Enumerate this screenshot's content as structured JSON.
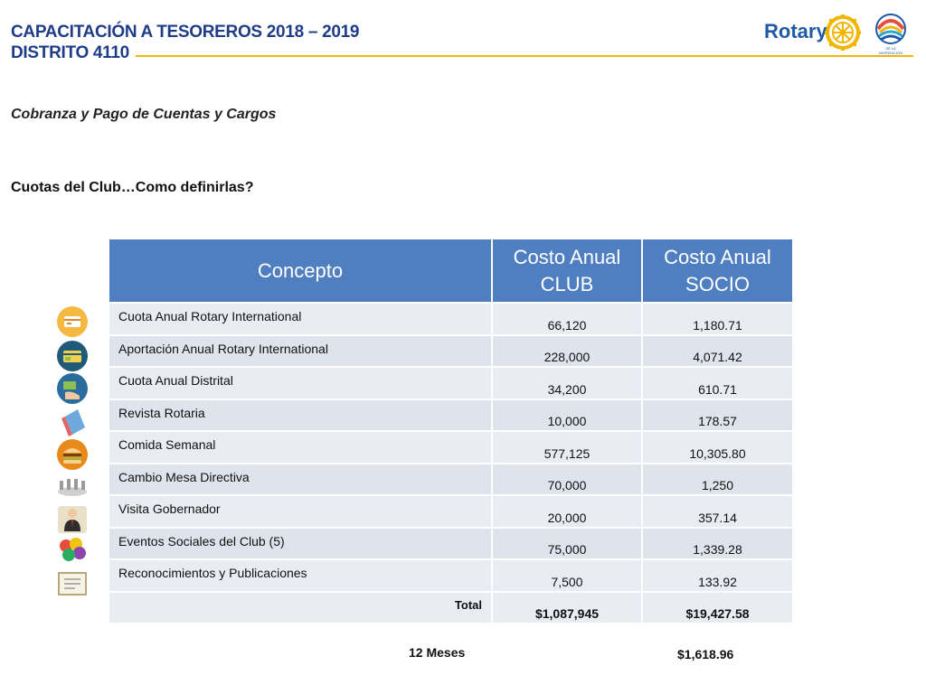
{
  "header": {
    "title_line1": "CAPACITACIÓN A TESOREROS 2018 – 2019",
    "title_line2": "DISTRITO 4110",
    "logo_text": "Rotary",
    "badge_caption": "SÉ LA INSPIRACIÓN",
    "accent_color": "#f2b600",
    "brand_color": "#1f3c88"
  },
  "subtitle": "Cobranza y Pago de Cuentas y Cargos",
  "question": "Cuotas del Club…Como definirlas?",
  "table": {
    "headers": [
      "Concepto",
      "Costo Anual CLUB",
      "Costo Anual SOCIO"
    ],
    "header_color": "#4f7fc1",
    "rows": [
      {
        "concepto": "Cuota Anual Rotary International",
        "club": "66,120",
        "socio": "1,180.71",
        "icon": "credit-card-icon"
      },
      {
        "concepto": "Aportación Anual Rotary International",
        "club": "228,000",
        "socio": "4,071.42",
        "icon": "payment-card-icon"
      },
      {
        "concepto": "Cuota Anual Distrital",
        "club": "34,200",
        "socio": "610.71",
        "icon": "hand-payment-icon"
      },
      {
        "concepto": "Revista Rotaria",
        "club": "10,000",
        "socio": "178.57",
        "icon": "magazine-icon"
      },
      {
        "concepto": "Comida Semanal",
        "club": "577,125",
        "socio": "10,305.80",
        "icon": "burger-icon"
      },
      {
        "concepto": "Cambio Mesa Directiva",
        "club": "70,000",
        "socio": "1,250",
        "icon": "banquet-table-icon"
      },
      {
        "concepto": "Visita Gobernador",
        "club": "20,000",
        "socio": "357.14",
        "icon": "businessman-icon"
      },
      {
        "concepto": "Eventos Sociales del Club (5)",
        "club": "75,000",
        "socio": "1,339.28",
        "icon": "balloons-icon"
      },
      {
        "concepto": "Reconocimientos y Publicaciones",
        "club": "7,500",
        "socio": "133.92",
        "icon": "certificate-icon"
      }
    ],
    "total_label": "Total",
    "total_club": "$1,087,945",
    "total_socio": "$19,427.58"
  },
  "footer": {
    "months_label": "12 Meses",
    "monthly_socio": "$1,618.96"
  }
}
